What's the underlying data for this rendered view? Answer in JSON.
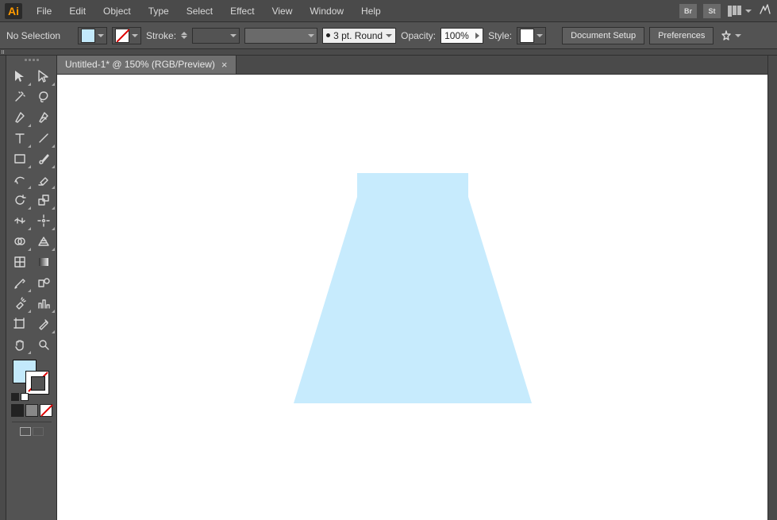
{
  "app": {
    "logo": "Ai"
  },
  "menu": {
    "items": [
      "File",
      "Edit",
      "Object",
      "Type",
      "Select",
      "Effect",
      "View",
      "Window",
      "Help"
    ],
    "br": "Br",
    "st": "St"
  },
  "control": {
    "selection": "No Selection",
    "stroke_label": "Stroke:",
    "brush_label": "3 pt. Round",
    "opacity_label": "Opacity:",
    "opacity_value": "100%",
    "style_label": "Style:",
    "doc_setup": "Document Setup",
    "preferences": "Preferences"
  },
  "tab": {
    "title": "Untitled-1* @ 150% (RGB/Preview)"
  },
  "colors": {
    "fill": "#c3e9fb",
    "shape": "#c7ebfd"
  }
}
